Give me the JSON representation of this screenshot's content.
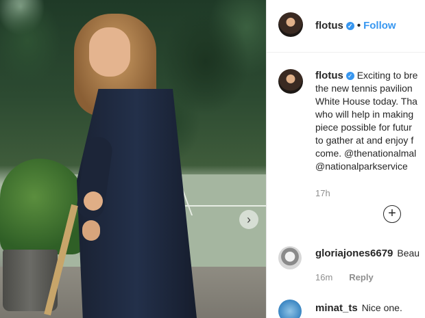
{
  "post": {
    "username": "flotus",
    "follow_label": "Follow",
    "caption_lines": [
      "Exciting to bre",
      "the new tennis pavilion",
      "White House today. Tha",
      "who will help in making",
      "piece possible for futur",
      "to gather at and enjoy f",
      "come. @thenationalmal",
      "@nationalparkservice"
    ],
    "caption_time": "17h"
  },
  "comments": [
    {
      "username": "gloriajones6679",
      "text": "Beau",
      "time": "16m",
      "reply_label": "Reply"
    },
    {
      "username": "minat_ts",
      "text": "Nice one."
    }
  ],
  "icons": {
    "verified": "verified-badge-icon",
    "next": "chevron-right-icon",
    "load_more": "plus-circle-icon"
  },
  "colors": {
    "link": "#3897f0",
    "text": "#262626",
    "muted": "#8e8e8e"
  }
}
